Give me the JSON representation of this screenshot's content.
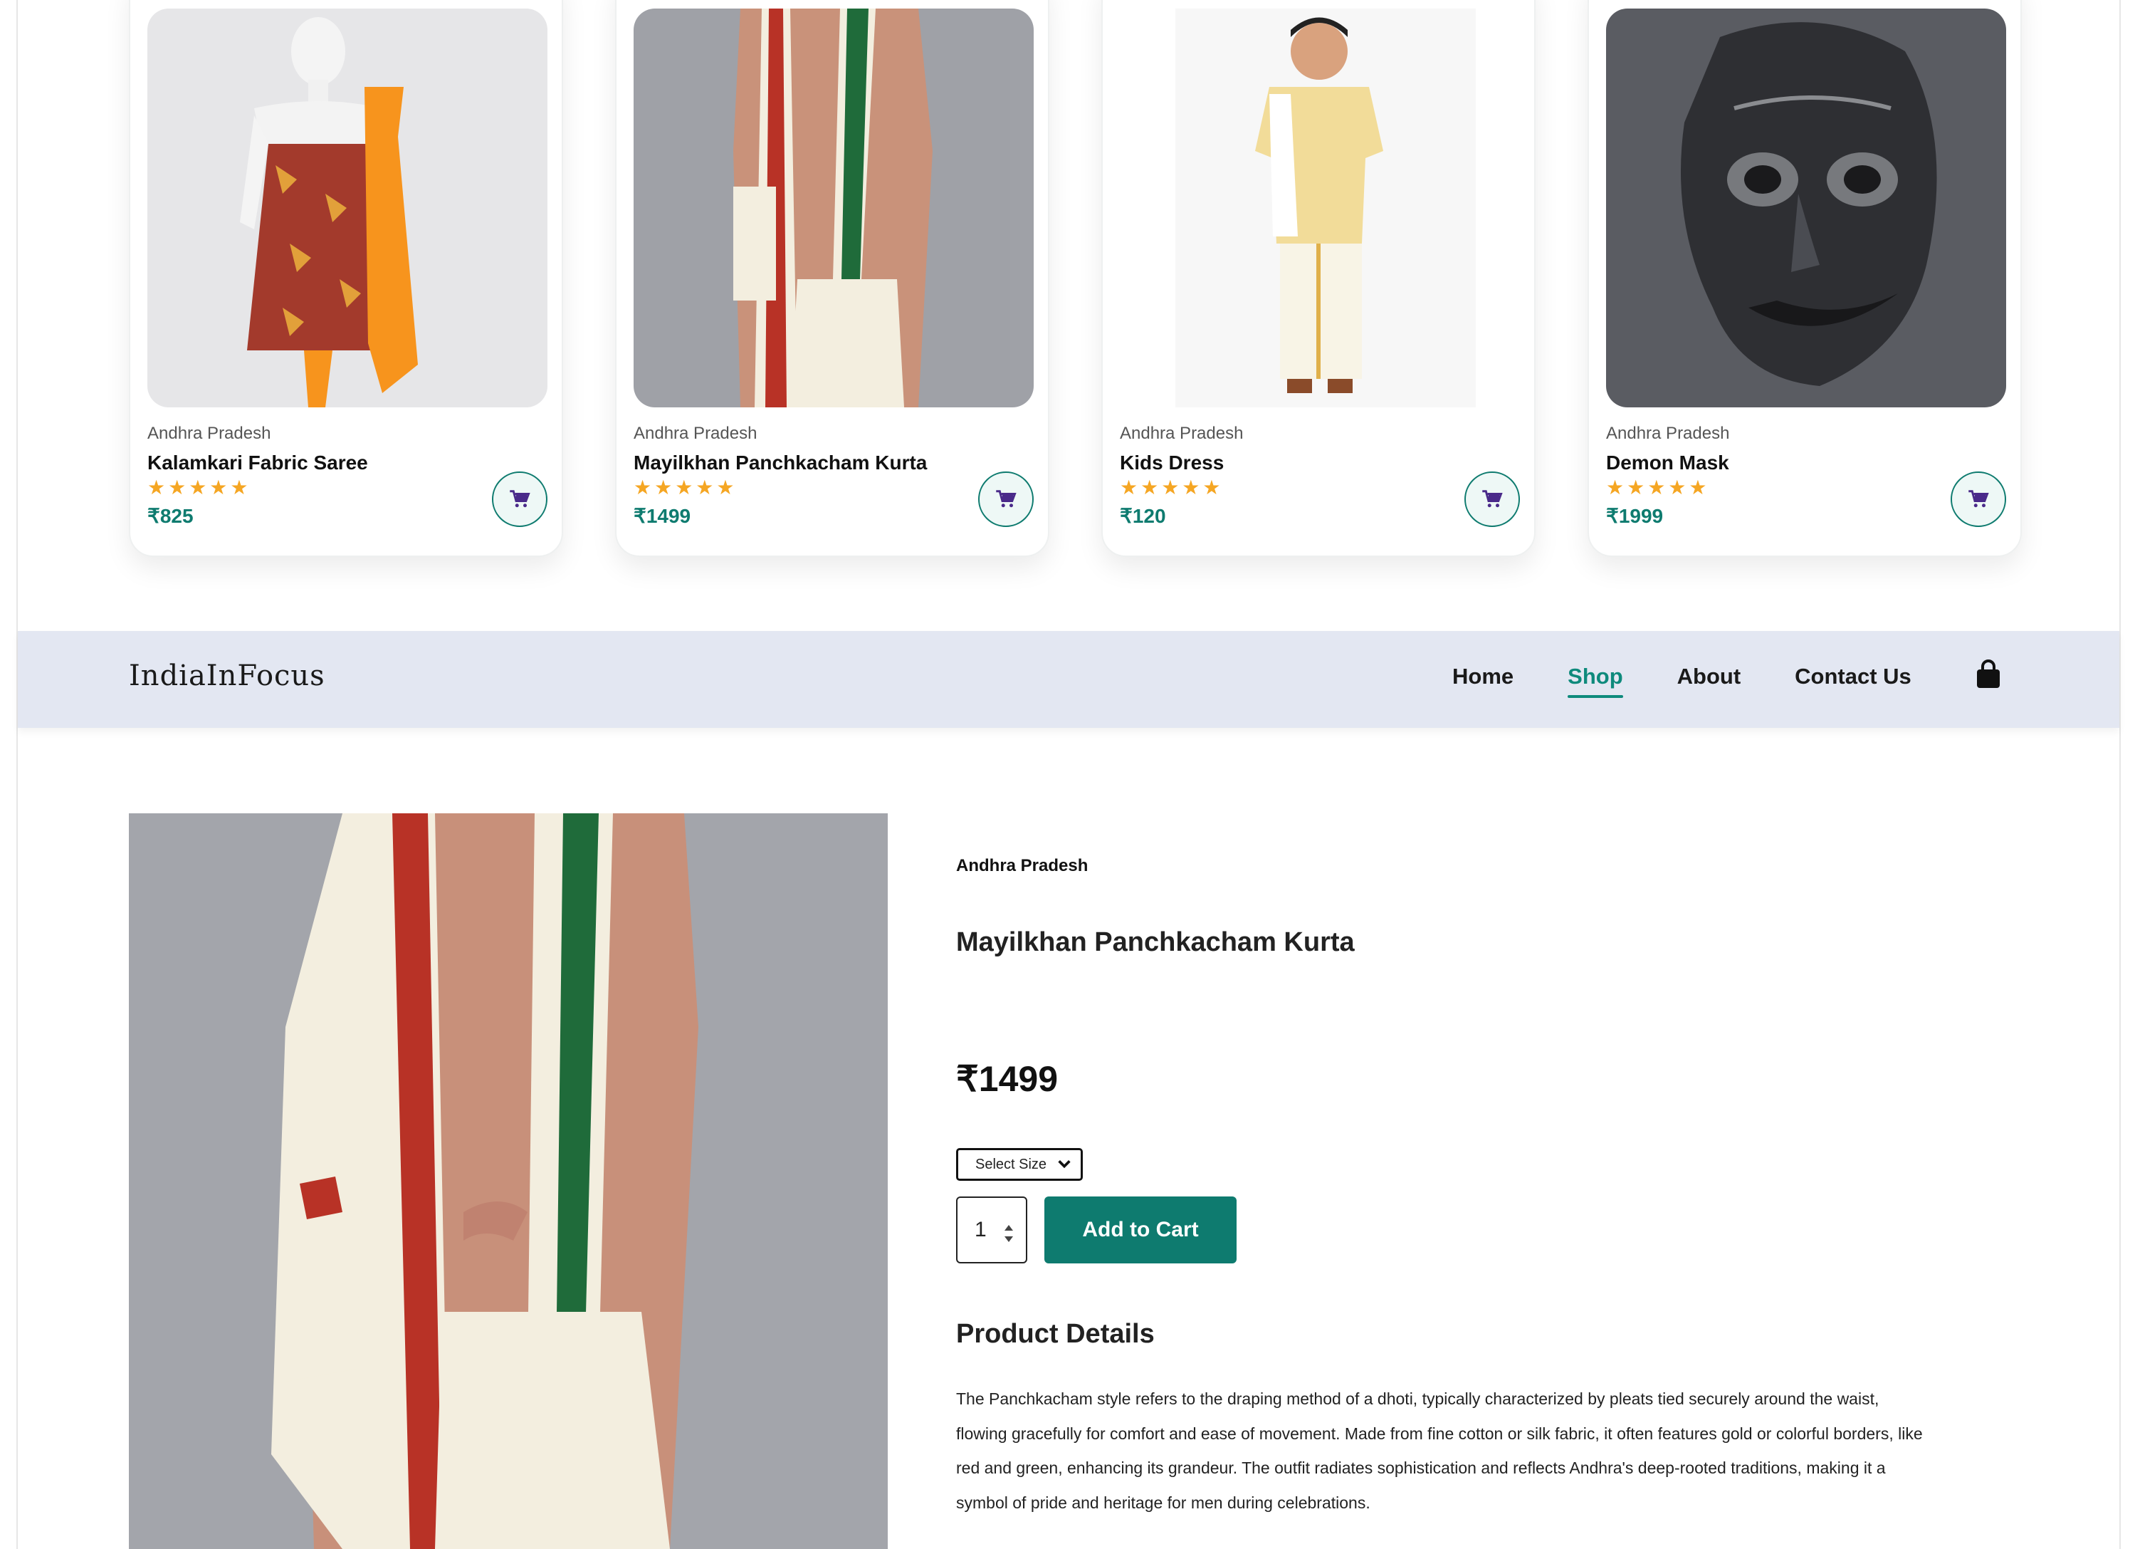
{
  "products": [
    {
      "region": "Andhra Pradesh",
      "name": "Kalamkari Fabric Saree",
      "rating": 5,
      "stars": "★★★★★",
      "price": "₹825",
      "image": "mannequin-saree"
    },
    {
      "region": "Andhra Pradesh",
      "name": "Mayilkhan Panchkacham Kurta",
      "rating": 5,
      "stars": "★★★★★",
      "price": "₹1499",
      "image": "man-panchkacham"
    },
    {
      "region": "Andhra Pradesh",
      "name": "Kids Dress",
      "rating": 5,
      "stars": "★★★★★",
      "price": "₹120",
      "image": "boy-kids-dress"
    },
    {
      "region": "Andhra Pradesh",
      "name": "Demon Mask",
      "rating": 5,
      "stars": "★★★★★",
      "price": "₹1999",
      "image": "demon-mask"
    }
  ],
  "navbar": {
    "logo": "IndiaInFocus",
    "links": [
      "Home",
      "Shop",
      "About",
      "Contact Us"
    ],
    "active": "Shop",
    "cart_icon": "shopping-bag-icon"
  },
  "detail": {
    "region": "Andhra Pradesh",
    "title": "Mayilkhan Panchkacham Kurta",
    "price": "₹1499",
    "size_select": "Select Size",
    "quantity": "1",
    "add_to_cart": "Add to Cart",
    "details_heading": "Product Details",
    "description": "The Panchkacham style refers to the draping method of a dhoti, typically characterized by pleats tied securely around the waist, flowing gracefully for comfort and ease of movement. Made from fine cotton or silk fabric, it often features gold or colorful borders, like red and green, enhancing its grandeur. The outfit radiates sophistication and reflects Andhra's deep-rooted traditions, making it a symbol of pride and heritage for men during celebrations."
  },
  "colors": {
    "accent": "#0e7b6f",
    "star": "#f5a623",
    "navbar_bg": "#e3e7f2"
  }
}
